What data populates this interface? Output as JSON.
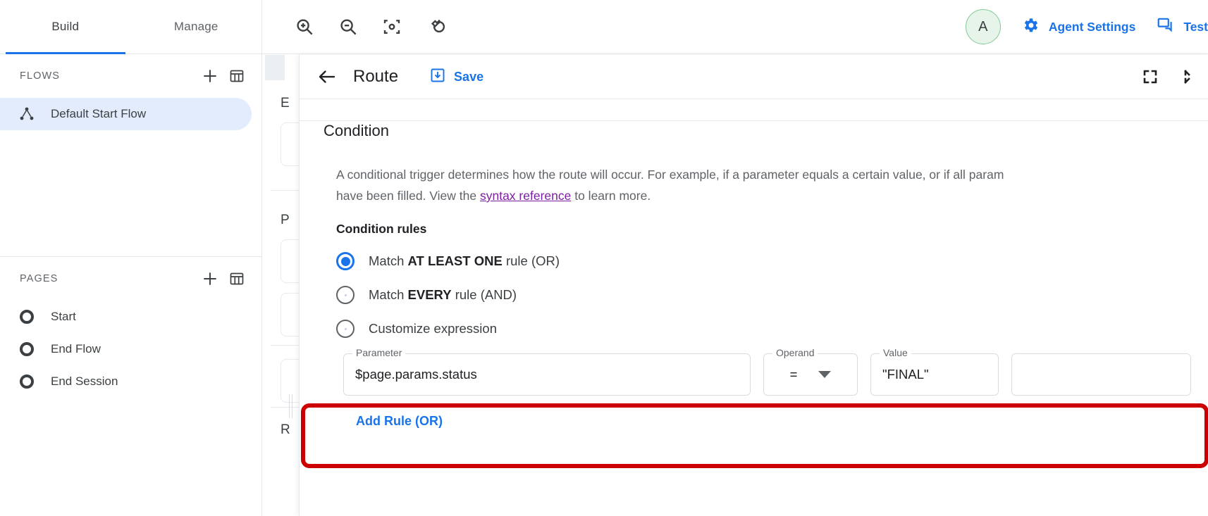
{
  "sidebar": {
    "tabs": [
      {
        "label": "Build",
        "active": true
      },
      {
        "label": "Manage",
        "active": false
      }
    ],
    "flows": {
      "title": "FLOWS",
      "add_icon": "plus-icon",
      "table_icon": "table-view-icon",
      "items": [
        {
          "label": "Default Start Flow",
          "icon": "flow-icon",
          "selected": true
        }
      ]
    },
    "pages": {
      "title": "PAGES",
      "add_icon": "plus-icon",
      "table_icon": "table-view-icon",
      "items": [
        {
          "label": "Start",
          "icon": "page-circle-icon"
        },
        {
          "label": "End Flow",
          "icon": "page-circle-icon"
        },
        {
          "label": "End Session",
          "icon": "page-circle-icon"
        }
      ]
    }
  },
  "toolbar": {
    "tools": [
      {
        "name": "zoom-in-icon"
      },
      {
        "name": "zoom-out-icon"
      },
      {
        "name": "fit-to-screen-icon"
      },
      {
        "name": "reset-view-icon"
      }
    ],
    "avatar_initial": "A",
    "agent_settings_label": "Agent Settings",
    "agent_settings_icon": "gear-icon",
    "test_label": "Test",
    "test_icon": "chat-test-icon"
  },
  "background_panel": {
    "labels": [
      "E",
      "P",
      "R"
    ]
  },
  "route": {
    "title": "Route",
    "back_icon": "back-arrow-icon",
    "save_label": "Save",
    "save_icon": "save-download-icon",
    "fullscreen_icon": "expand-fullscreen-icon",
    "collapse_icon": "collapse-icon",
    "condition_heading": "Condition",
    "description_part1": "A conditional trigger determines how the route will occur. For example, if a parameter equals a certain value, or if all param",
    "description_part2": "have been filled. View the ",
    "description_link": "syntax reference",
    "description_part3": " to learn more.",
    "condition_rules_label": "Condition rules",
    "radio_options": [
      {
        "text_before": "Match ",
        "bold": "AT LEAST ONE",
        "text_after": " rule (OR)",
        "selected": true
      },
      {
        "text_before": "Match ",
        "bold": "EVERY",
        "text_after": " rule (AND)",
        "selected": false
      },
      {
        "text_before": "Customize expression",
        "bold": "",
        "text_after": "",
        "selected": false
      }
    ],
    "rule": {
      "parameter_label": "Parameter",
      "parameter_value": "$page.params.status",
      "operand_label": "Operand",
      "operand_value": "=",
      "operand_caret": "chevron-down-icon",
      "value_label": "Value",
      "value_value": "\"FINAL\""
    },
    "add_rule_label": "Add Rule (OR)",
    "highlight_color": "#cc0000"
  }
}
